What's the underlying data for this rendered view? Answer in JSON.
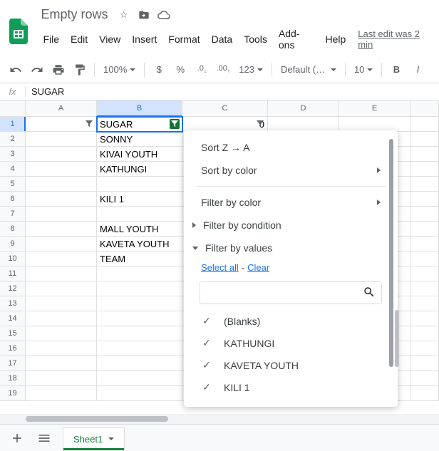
{
  "doc": {
    "title": "Empty rows"
  },
  "menu": {
    "file": "File",
    "edit": "Edit",
    "view": "View",
    "insert": "Insert",
    "format": "Format",
    "data": "Data",
    "tools": "Tools",
    "addons": "Add-ons",
    "help": "Help",
    "last_edit": "Last edit was 2 min"
  },
  "toolbar": {
    "zoom": "100%",
    "currency": "$",
    "percent": "%",
    "dec_dec": ".0",
    "dec_inc": ".00",
    "num_format": "123",
    "font": "Default (Ari...",
    "font_size": "10",
    "bold": "B",
    "italic": "I"
  },
  "formula": {
    "fx": "fx",
    "value": "SUGAR"
  },
  "columns": [
    "A",
    "B",
    "C",
    "D",
    "E",
    ""
  ],
  "rows": [
    {
      "n": "1",
      "A": "",
      "B": "SUGAR",
      "C": "0"
    },
    {
      "n": "2",
      "A": "",
      "B": "SONNY",
      "C": ""
    },
    {
      "n": "3",
      "A": "",
      "B": "KIVAI YOUTH",
      "C": ""
    },
    {
      "n": "4",
      "A": "",
      "B": "KATHUNGI",
      "C": ""
    },
    {
      "n": "5",
      "A": "",
      "B": "",
      "C": ""
    },
    {
      "n": "6",
      "A": "",
      "B": "KILI 1",
      "C": ""
    },
    {
      "n": "7",
      "A": "",
      "B": "",
      "C": ""
    },
    {
      "n": "8",
      "A": "",
      "B": "MALL YOUTH",
      "C": ""
    },
    {
      "n": "9",
      "A": "",
      "B": "KAVETA YOUTH",
      "C": ""
    },
    {
      "n": "10",
      "A": "",
      "B": "TEAM",
      "C": ""
    },
    {
      "n": "11",
      "A": "",
      "B": "",
      "C": ""
    },
    {
      "n": "12",
      "A": "",
      "B": "",
      "C": ""
    },
    {
      "n": "13",
      "A": "",
      "B": "",
      "C": ""
    },
    {
      "n": "14",
      "A": "",
      "B": "",
      "C": ""
    },
    {
      "n": "15",
      "A": "",
      "B": "",
      "C": ""
    },
    {
      "n": "16",
      "A": "",
      "B": "",
      "C": ""
    },
    {
      "n": "17",
      "A": "",
      "B": "",
      "C": ""
    },
    {
      "n": "18",
      "A": "",
      "B": "",
      "C": ""
    },
    {
      "n": "19",
      "A": "",
      "B": "",
      "C": ""
    }
  ],
  "filter_dd": {
    "sort_za": "Sort Z → A",
    "sort_color": "Sort by color",
    "filt_color": "Filter by color",
    "filt_cond": "Filter by condition",
    "filt_vals": "Filter by values",
    "select_all": "Select all",
    "clear": "Clear",
    "search_placeholder": "",
    "values": [
      "(Blanks)",
      "KATHUNGI",
      "KAVETA YOUTH",
      "KILI 1"
    ]
  },
  "sheet": {
    "name": "Sheet1"
  }
}
